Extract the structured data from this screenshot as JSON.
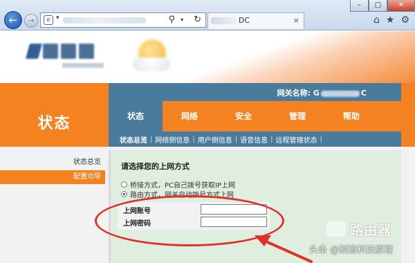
{
  "browser": {
    "window_controls": [
      "–",
      "□",
      "✕"
    ],
    "tab_title": "DC",
    "address_icons": [
      "search-icon",
      "refresh-icon"
    ],
    "toolbar_icons": [
      "home-icon",
      "favorites-star-icon",
      "settings-gear-icon"
    ]
  },
  "router": {
    "name_label": "网关名称: G",
    "name_suffix": "C",
    "page_title": "状态",
    "nav_tabs": [
      "状态",
      "网络",
      "安全",
      "管理",
      "帮助"
    ],
    "active_tab": "状态",
    "subnav": [
      "状态总览",
      "网络侧信息",
      "用户侧信息",
      "语音信息",
      "远程管理状态"
    ],
    "sidebar": [
      "状态总览",
      "配置向导"
    ],
    "active_sidebar": "配置向导",
    "content_title": "请选择您的上网方式",
    "options": [
      {
        "label": "桥接方式，PC自己拨号获取IP上网",
        "checked": false
      },
      {
        "label": "路由方式，网关自动拨号方式上网",
        "checked": true
      }
    ],
    "fields": [
      {
        "label": "上网账号",
        "value": ""
      },
      {
        "label": "上网密码",
        "value": ""
      }
    ],
    "brand_color": "#f58220",
    "nav_blue": "#4a7b9d",
    "content_bg": "#e0eedf"
  },
  "annotations": {
    "highlight_color": "#e0302c"
  },
  "watermark": {
    "brand": "路由器",
    "credit": "头条 @制造科技原理"
  }
}
